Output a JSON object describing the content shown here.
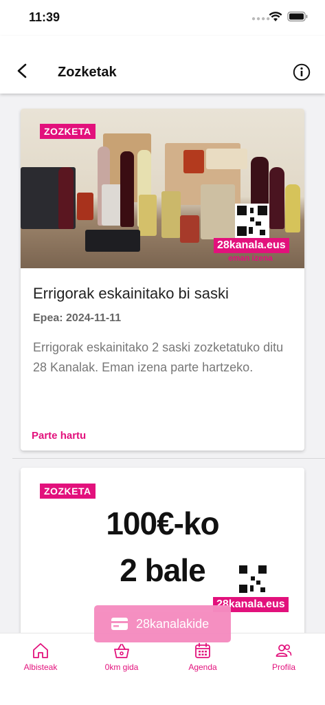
{
  "status": {
    "time": "11:39"
  },
  "header": {
    "title": "Zozketak"
  },
  "cards": [
    {
      "tag": "ZOZKETA",
      "brand": "28kanala.eus",
      "cta_small": "eman izena",
      "title": "Errigorak eskainitako bi saski",
      "date": "Epea: 2024-11-11",
      "description": "Errigorak eskainitako 2 saski zozketatuko ditu 28 Kanalak. Eman izena parte hartzeko.",
      "link": "Parte hartu"
    },
    {
      "tag": "ZOZKETA",
      "headline_1": "100€-ko",
      "headline_2": "2 bale",
      "brand": "28kanala.eus"
    }
  ],
  "floating_button": {
    "label": "28kanalakide"
  },
  "tabs": [
    {
      "label": "Albisteak",
      "icon": "home-icon"
    },
    {
      "label": "0km gida",
      "icon": "basket-icon"
    },
    {
      "label": "Agenda",
      "icon": "calendar-icon"
    },
    {
      "label": "Profila",
      "icon": "users-icon"
    }
  ],
  "colors": {
    "accent": "#e2117c",
    "floating": "#f58cc0"
  }
}
